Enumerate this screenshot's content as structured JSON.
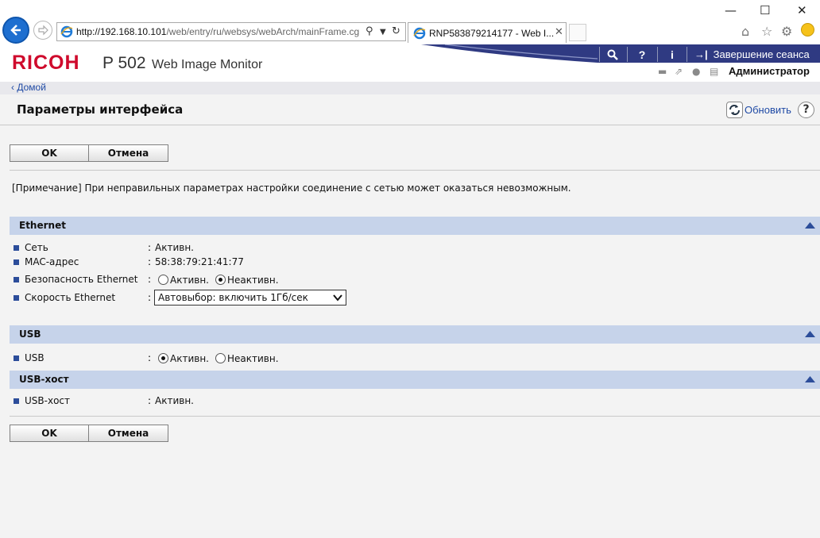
{
  "browser": {
    "url_host": "http://192.168.10.101",
    "url_path": "/web/entry/ru/websys/webArch/mainFrame.cg",
    "tab_title": "RNP583879214177 - Web I...",
    "window_controls": {
      "minimize": "—",
      "maximize": "☐",
      "close": "✕"
    }
  },
  "header": {
    "logo": "RICOH",
    "model": "P 502",
    "product": "Web Image Monitor",
    "search_icon": "search-icon",
    "help_label": "?",
    "info_label": "i",
    "logout_label": "Завершение сеанса",
    "user_label": "Администратор"
  },
  "nav": {
    "home_label": "Домой"
  },
  "page": {
    "title": "Параметры интерфейса",
    "refresh_label": "Обновить",
    "help_label": "?",
    "ok_label": "OK",
    "cancel_label": "Отмена",
    "note": "[Примечание] При неправильных параметрах настройки соединение с сетью может оказаться невозможным."
  },
  "sections": {
    "ethernet": {
      "title": "Ethernet",
      "network_label": "Сеть",
      "network_value": "Активн.",
      "mac_label": "MAC-адрес",
      "mac_value": "58:38:79:21:41:77",
      "security_label": "Безопасность Ethernet",
      "security_on": "Активн.",
      "security_off": "Неактивн.",
      "security_selected": "Неактивн.",
      "speed_label": "Скорость Ethernet",
      "speed_value": "Автовыбор: включить 1Гб/сек"
    },
    "usb": {
      "title": "USB",
      "usb_label": "USB",
      "usb_on": "Активн.",
      "usb_off": "Неактивн.",
      "usb_selected": "Активн."
    },
    "usb_host": {
      "title": "USB-хост",
      "host_label": "USB-хост",
      "host_value": "Активн."
    }
  },
  "colors": {
    "section_bg": "#c6d3ea",
    "bullet": "#2c4d9a",
    "header_band": "#2f3a82",
    "brand_red": "#cf0a2c",
    "link": "#1f4aa5"
  }
}
